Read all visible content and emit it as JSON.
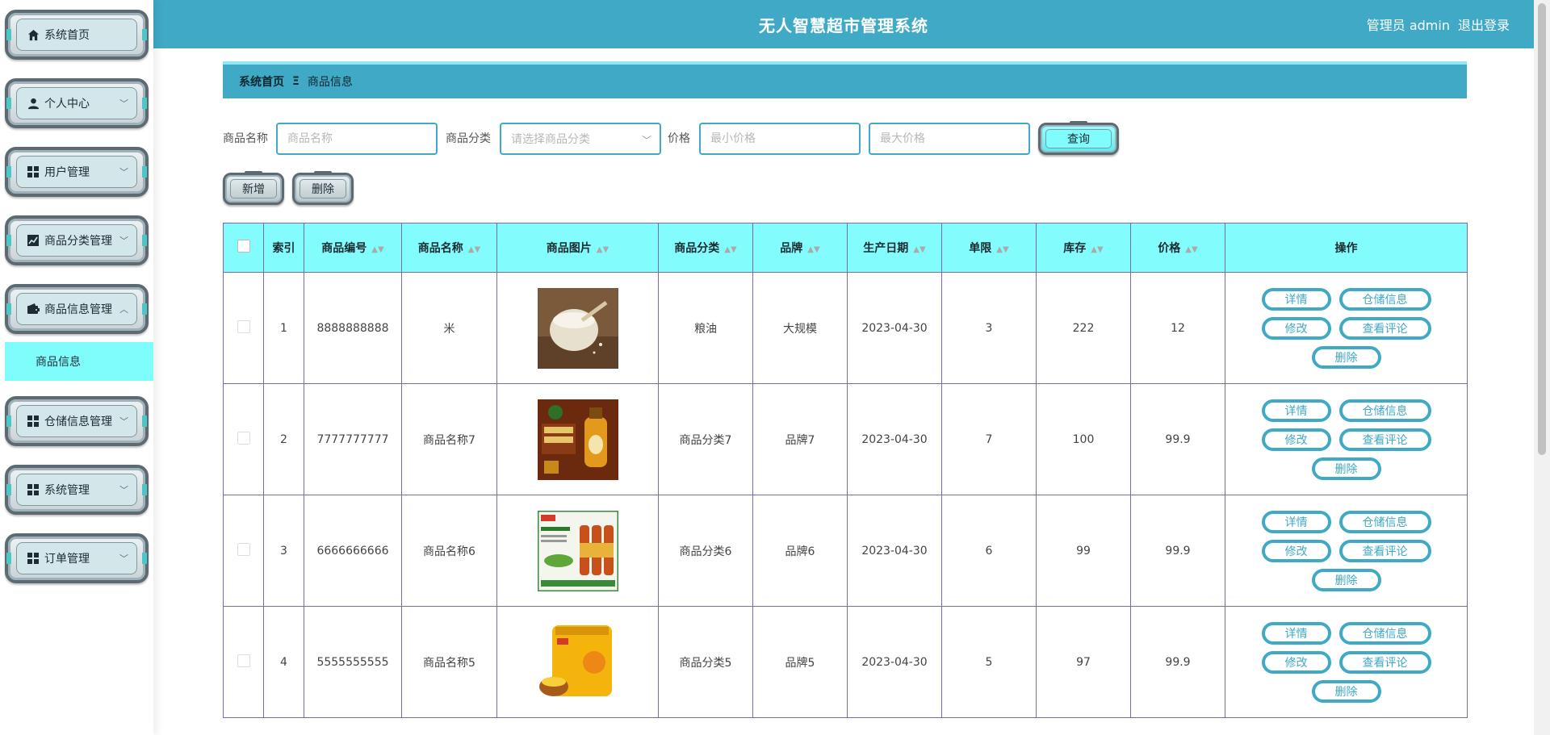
{
  "header": {
    "title": "无人智慧超市管理系统",
    "user": "管理员 admin",
    "logout": "退出登录"
  },
  "sidebar": {
    "items": [
      {
        "label": "系统首页",
        "icon": "home-icon",
        "expandable": false
      },
      {
        "label": "个人中心",
        "icon": "person-icon",
        "expandable": true
      },
      {
        "label": "用户管理",
        "icon": "grid-icon",
        "expandable": true
      },
      {
        "label": "商品分类管理",
        "icon": "chart-icon",
        "expandable": true
      },
      {
        "label": "商品信息管理",
        "icon": "wallet-icon",
        "expandable": true,
        "expanded": true
      },
      {
        "label": "仓储信息管理",
        "icon": "grid-icon",
        "expandable": true
      },
      {
        "label": "系统管理",
        "icon": "grid-icon",
        "expandable": true
      },
      {
        "label": "订单管理",
        "icon": "grid-icon",
        "expandable": true
      }
    ],
    "submenu": {
      "label": "商品信息"
    }
  },
  "breadcrumb": {
    "home": "系统首页",
    "separator": "Ξ",
    "current": "商品信息"
  },
  "search": {
    "name_label": "商品名称",
    "name_placeholder": "商品名称",
    "category_label": "商品分类",
    "category_placeholder": "请选择商品分类",
    "price_label": "价格",
    "min_placeholder": "最小价格",
    "max_placeholder": "最大价格",
    "query_button": "查询"
  },
  "actions": {
    "add": "新增",
    "delete": "删除"
  },
  "table": {
    "headers": [
      "索引",
      "商品编号",
      "商品名称",
      "商品图片",
      "商品分类",
      "品牌",
      "生产日期",
      "单限",
      "库存",
      "价格",
      "操作"
    ],
    "rows": [
      {
        "index": "1",
        "code": "8888888888",
        "name": "米",
        "category": "粮油",
        "brand": "大规模",
        "date": "2023-04-30",
        "limit": "3",
        "stock": "222",
        "price": "12",
        "image": "rice-image"
      },
      {
        "index": "2",
        "code": "7777777777",
        "name": "商品名称7",
        "category": "商品分类7",
        "brand": "品牌7",
        "date": "2023-04-30",
        "limit": "7",
        "stock": "100",
        "price": "99.9",
        "image": "oil-bottle-image"
      },
      {
        "index": "3",
        "code": "6666666666",
        "name": "商品名称6",
        "category": "商品分类6",
        "brand": "品牌6",
        "date": "2023-04-30",
        "limit": "6",
        "stock": "99",
        "price": "99.9",
        "image": "cooking-wine-image"
      },
      {
        "index": "4",
        "code": "5555555555",
        "name": "商品名称5",
        "category": "商品分类5",
        "brand": "品牌5",
        "date": "2023-04-30",
        "limit": "5",
        "stock": "97",
        "price": "99.9",
        "image": "millet-bag-image"
      }
    ],
    "row_buttons": {
      "detail": "详情",
      "storage": "仓储信息",
      "edit": "修改",
      "comments": "查看评论",
      "delete": "删除"
    }
  },
  "colors": {
    "header_bg": "#3fa9c6",
    "table_header_bg": "#82fcfc",
    "submenu_bg": "#7ffcfc",
    "button_border": "#3fa9c6",
    "table_border": "#7a6aa8"
  }
}
